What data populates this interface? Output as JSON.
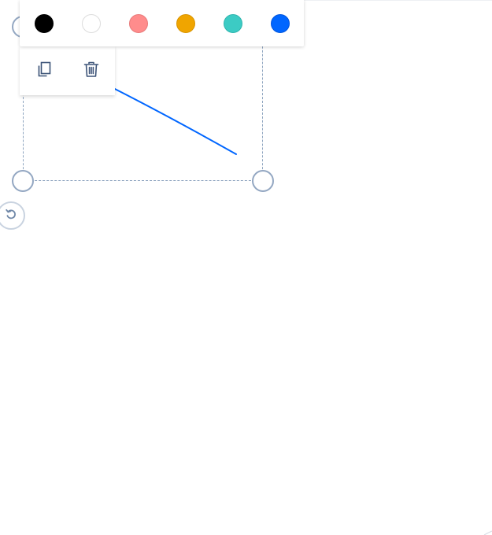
{
  "toolbar": {
    "colors": [
      {
        "name": "black",
        "value": "#000000",
        "border": "#000000"
      },
      {
        "name": "white",
        "value": "#ffffff",
        "border": "#dcdcdc"
      },
      {
        "name": "coral",
        "value": "#ff8c8c",
        "border": "#e87a7a"
      },
      {
        "name": "amber",
        "value": "#f0a500",
        "border": "#d99400"
      },
      {
        "name": "teal",
        "value": "#3ccbc4",
        "border": "#2fb5ae"
      },
      {
        "name": "blue",
        "value": "#0066ff",
        "border": "#0055dd"
      }
    ],
    "actions": [
      {
        "name": "duplicate",
        "icon": "copy-icon"
      },
      {
        "name": "delete",
        "icon": "trash-icon"
      }
    ]
  },
  "shape": {
    "type": "line",
    "stroke_color": "#0066ff"
  },
  "selection": {
    "frame_color": "#8fa5c0",
    "handle_color": "#93a7c2",
    "rotate_icon": "rotate-icon"
  }
}
